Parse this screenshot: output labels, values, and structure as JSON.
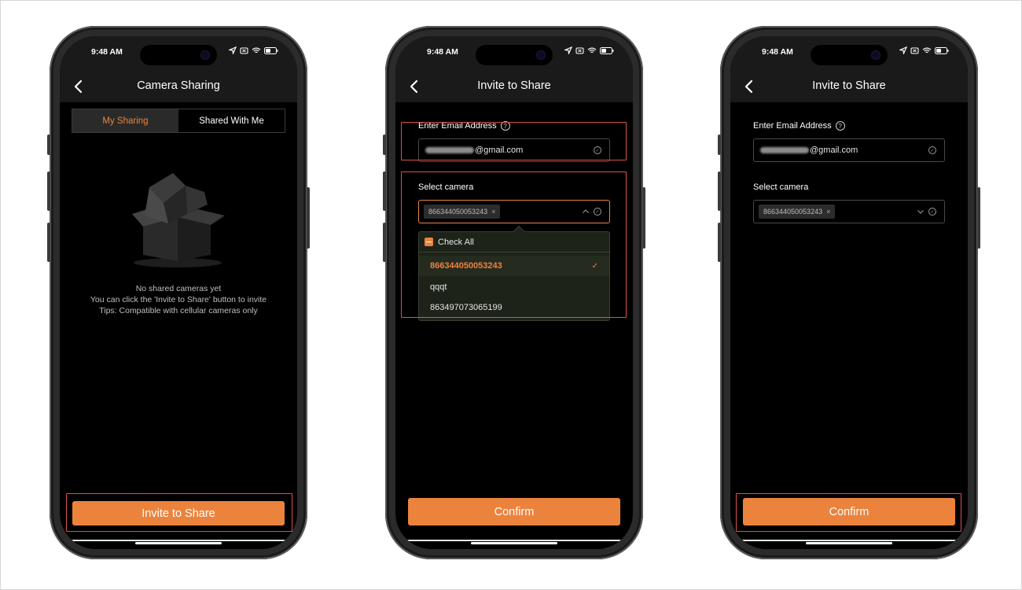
{
  "status": {
    "time": "9:48 AM"
  },
  "phone1": {
    "title": "Camera Sharing",
    "tabs": [
      {
        "label": "My Sharing"
      },
      {
        "label": "Shared With Me"
      }
    ],
    "empty": {
      "line1": "No shared cameras yet",
      "line2": "You can click the 'Invite to Share' button to invite",
      "line3": "Tips: Compatible with cellular cameras only"
    },
    "invite_button": "Invite to Share"
  },
  "phone2": {
    "title": "Invite to Share",
    "email_label": "Enter Email Address",
    "email_suffix": "@gmail.com",
    "camera_label": "Select camera",
    "selected_chip": "866344050053243",
    "dropdown": {
      "check_all": "Check All",
      "options": [
        {
          "label": "866344050053243"
        },
        {
          "label": "qqqt"
        },
        {
          "label": "863497073065199"
        }
      ]
    },
    "confirm_button": "Confirm"
  },
  "phone3": {
    "title": "Invite to Share",
    "email_label": "Enter Email Address",
    "email_suffix": "@gmail.com",
    "camera_label": "Select camera",
    "selected_chip": "866344050053243",
    "confirm_button": "Confirm"
  },
  "colors": {
    "accent": "#ec833d",
    "highlight": "#d9534f",
    "bar": "#1a1a1a"
  }
}
